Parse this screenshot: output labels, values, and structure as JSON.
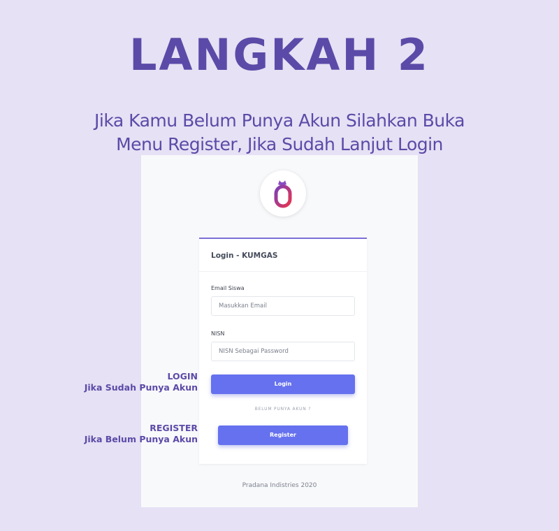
{
  "heading": "LANGKAH 2",
  "instruction": {
    "line1": "Jika Kamu Belum Punya Akun Silahkan Buka",
    "line2": "Menu Register, Jika Sudah Lanjut Login"
  },
  "app": {
    "logo_icon": "kumgas-logo-icon",
    "login_card": {
      "title": "Login - KUMGAS",
      "email": {
        "label": "Email Siswa",
        "placeholder": "Masukkan Email",
        "value": ""
      },
      "nisn": {
        "label": "NISN",
        "placeholder": "NISN Sebagai Password",
        "value": ""
      },
      "login_button": "Login",
      "no_account_text": "BELUM PUNYA AKUN ?",
      "register_button": "Register"
    },
    "footer": "Pradana Indistries 2020"
  },
  "annotations": {
    "login": {
      "title": "LOGIN",
      "desc": "Jika Sudah Punya Akun"
    },
    "register": {
      "title": "REGISTER",
      "desc": "Jika Belum Punya Akun"
    }
  },
  "colors": {
    "background": "#e6e1f4",
    "heading": "#5c4aa8",
    "button": "#6571ee",
    "card_border": "#7a6fd8"
  }
}
